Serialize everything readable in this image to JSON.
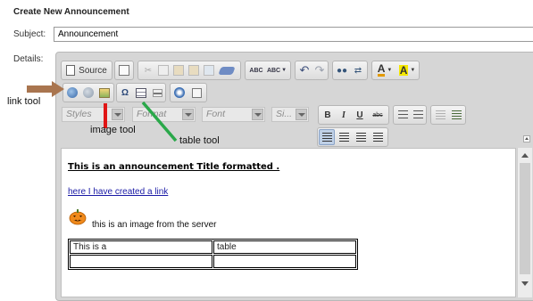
{
  "form": {
    "heading": "Create New Announcement",
    "subject_label": "Subject:",
    "subject_value": "Announcement",
    "details_label": "Details:"
  },
  "toolbar": {
    "source_label": "Source",
    "styles_placeholder": "Styles",
    "format_placeholder": "Format",
    "font_placeholder": "Font",
    "size_placeholder": "Si...",
    "bold_label": "B",
    "italic_label": "I",
    "underline_label": "U",
    "strike_label": "abc",
    "spell_label": "ABC",
    "text_color_label": "A",
    "bg_color_label": "A"
  },
  "content": {
    "title": "This is an announcement Title formatted .",
    "link_text": "here I have created a link",
    "image_caption": "this is an image from the server",
    "table": [
      [
        "This is  a",
        "table"
      ],
      [
        "",
        ""
      ]
    ]
  },
  "annotations": {
    "link_tool": "link tool",
    "image_tool": "image tool",
    "table_tool": "table tool"
  },
  "colors": {
    "arrow": "#a9754f",
    "image_line": "#e01515",
    "table_line": "#2aa84a"
  }
}
